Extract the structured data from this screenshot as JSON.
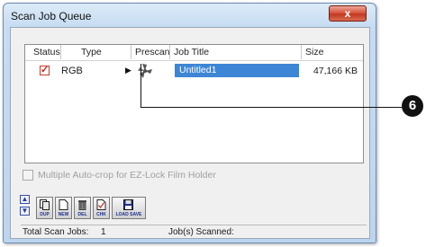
{
  "window": {
    "title": "Scan Job Queue",
    "close_label": "x"
  },
  "list": {
    "columns": [
      "Status",
      "Type",
      "Prescan",
      "Job Title",
      "Size"
    ],
    "rows": [
      {
        "status_mark": "✓",
        "type": "RGB",
        "job_title": "Untitled1",
        "size": "47,166 KB"
      }
    ]
  },
  "options": {
    "multi_autocrop_label": "Multiple Auto-crop for EZ-Lock Film Holder",
    "multi_autocrop_checked": false
  },
  "toolbar": {
    "buttons": [
      {
        "label": "DUP",
        "icon": "duplicate-icon"
      },
      {
        "label": "NEW",
        "icon": "new-job-icon"
      },
      {
        "label": "DEL",
        "icon": "trash-icon"
      },
      {
        "label": "CHK",
        "icon": "check-icon"
      },
      {
        "label": "LOAD SAVE",
        "icon": "floppy-disk-icon"
      }
    ]
  },
  "status": {
    "total_label": "Total Scan Jobs:",
    "total_value": "1",
    "scanned_label": "Job(s) Scanned:"
  },
  "callout": {
    "number": "6"
  },
  "colors": {
    "selection": "#3d86d6",
    "close_button": "#c94a33"
  }
}
